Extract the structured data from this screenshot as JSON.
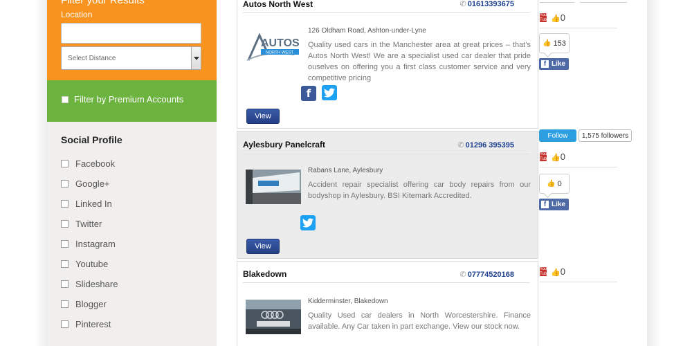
{
  "sidebar": {
    "filter_title": "Filter your Results",
    "location_label": "Location",
    "location_value": "",
    "distance_select": "Select Distance",
    "premium_filter": "Filter by Premium Accounts",
    "social_title": "Social Profile",
    "social_items": [
      "Facebook",
      "Google+",
      "Linked In",
      "Twitter",
      "Instagram",
      "Youtube",
      "Slideshare",
      "Blogger",
      "Pinterest"
    ]
  },
  "listings": [
    {
      "name": "Autos North West",
      "phone": "01613393675",
      "logo_text": "AUTOS",
      "logo_subtext": "NORTH WEST",
      "address": "126 Oldham Road, Ashton-under-Lyne",
      "description": "Quality used cars in the Manchester area at great prices – that’s Autos North West! We are a specialist used car dealer that pride ouselves on offering you a first class customer service and very competitive pricing",
      "view_label": "View",
      "youtube_count": "0",
      "likes": "153",
      "like_label": "Like"
    },
    {
      "name": "Aylesbury Panelcraft",
      "phone": "01296 395395",
      "address": "Rabans Lane, Aylesbury",
      "description": "Accident repair specialist offering car body repairs from our bodyshop in Aylesbury. BSI Kitemark Accredited.",
      "view_label": "View",
      "youtube_count": "0",
      "likes": "0",
      "like_label": "Like",
      "twitter_follow": "Follow",
      "twitter_followers": "1,575 followers"
    },
    {
      "name": "Blakedown",
      "phone": "07774520168",
      "address": "Kidderminster, Blakedown",
      "description": "Quality Used car dealers in North Worcestershire. Finance available. Any Car taken in part exchange. View our stock now.",
      "view_label": "View",
      "youtube_count": "0"
    }
  ],
  "icons": {
    "facebook": "facebook-icon",
    "twitter": "twitter-icon",
    "youtube": "youtube-icon",
    "phone": "phone-icon",
    "thumbs_up": "thumbs-up-icon"
  },
  "colors": {
    "filter_orange": "#f7931e",
    "premium_green": "#6db33f",
    "phone_blue": "#1d3f8f",
    "view_button": "#2d4b98"
  }
}
